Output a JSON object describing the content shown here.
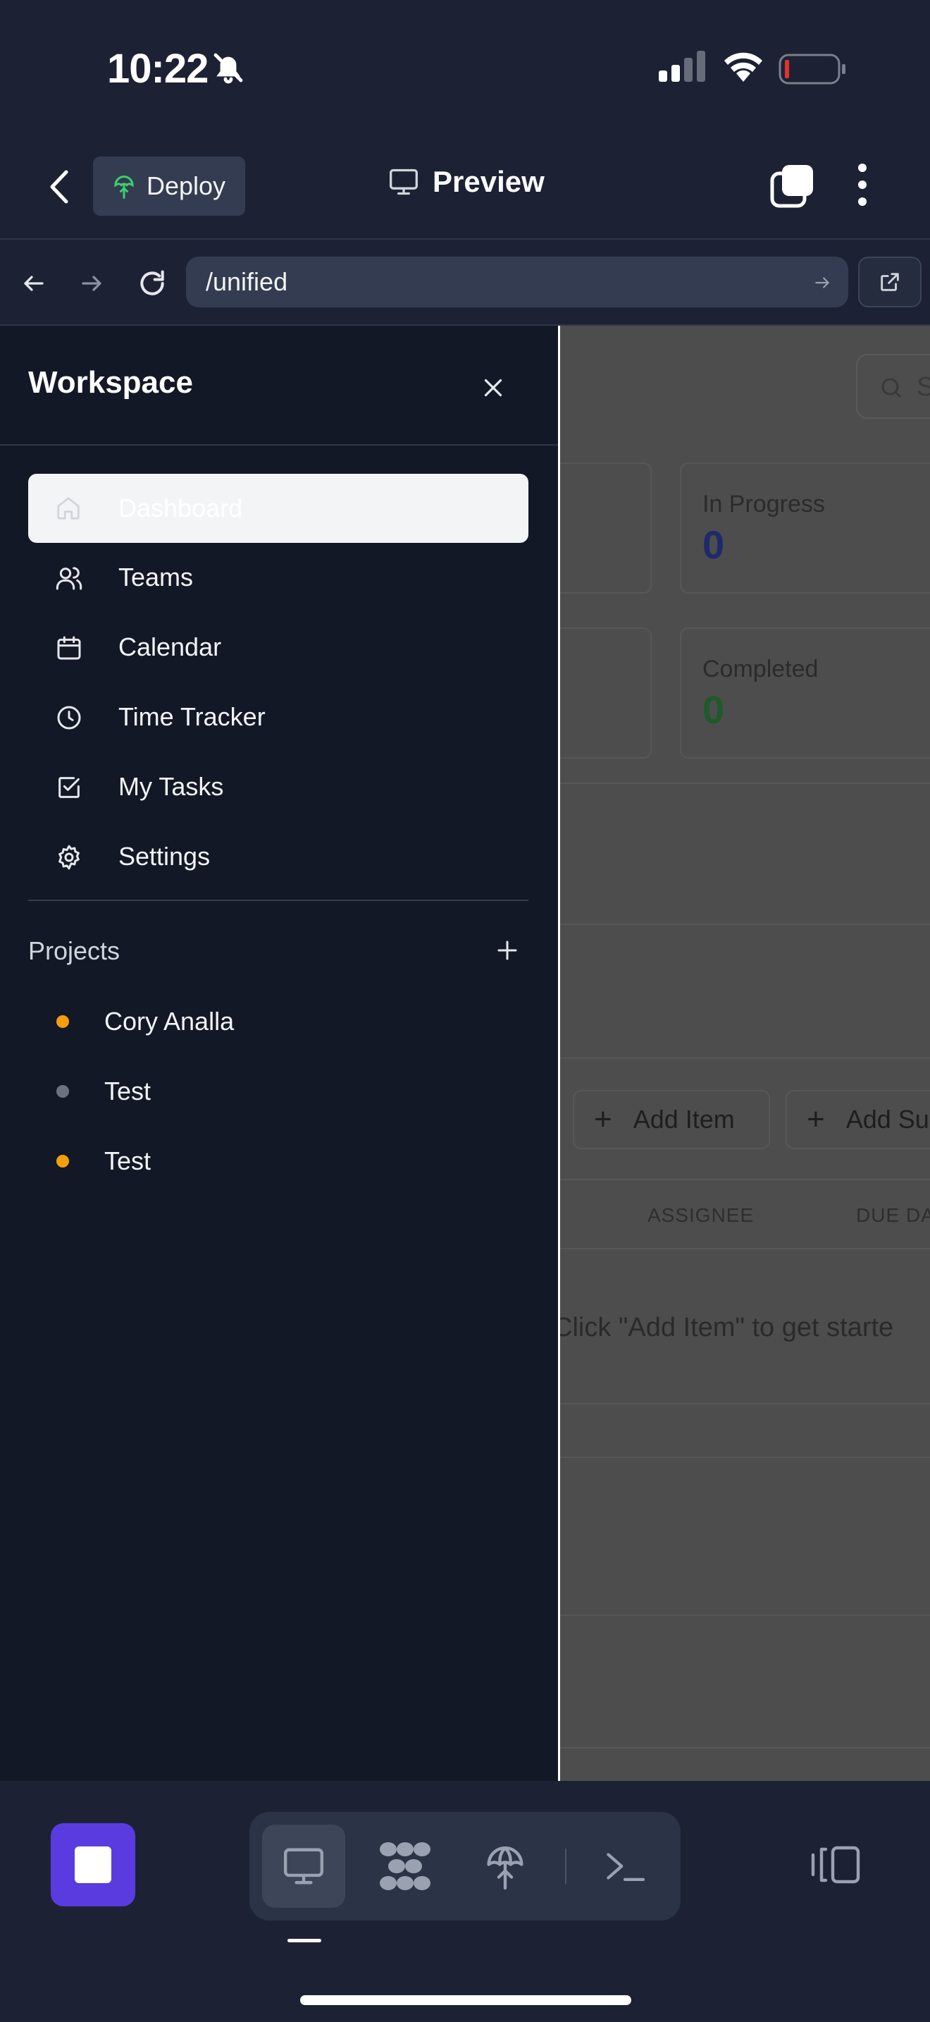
{
  "status_bar": {
    "time": "10:22"
  },
  "header": {
    "deploy_label": "Deploy",
    "title": "Preview"
  },
  "url_bar": {
    "url": "/unified"
  },
  "sidebar": {
    "title": "Workspace",
    "nav_items": [
      {
        "label": "Dashboard",
        "icon": "home-icon",
        "active": true
      },
      {
        "label": "Teams",
        "icon": "users-icon"
      },
      {
        "label": "Calendar",
        "icon": "calendar-icon"
      },
      {
        "label": "Time Tracker",
        "icon": "clock-icon"
      },
      {
        "label": "My Tasks",
        "icon": "checkbox-icon"
      },
      {
        "label": "Settings",
        "icon": "gear-icon"
      }
    ],
    "projects_label": "Projects",
    "projects": [
      {
        "label": "Cory Analla",
        "color": "#f59e0b"
      },
      {
        "label": "Test",
        "color": "#6b7280"
      },
      {
        "label": "Test",
        "color": "#f59e0b"
      }
    ]
  },
  "preview": {
    "search_placeholder": "S",
    "cards": [
      {
        "label": "In Progress",
        "value": "0",
        "color": "#1e2a6b"
      },
      {
        "label": "Completed",
        "value": "0",
        "color": "#1f5a2a"
      }
    ],
    "add_item_label": "Add Item",
    "add_sub_label": "Add Su",
    "columns": [
      "ASSIGNEE",
      "DUE DA"
    ],
    "empty_text": "Click \"Add Item\" to get starte"
  },
  "colors": {
    "accent": "#5a3be0",
    "background": "#1c2234",
    "sidebar": "#121826",
    "project_orange": "#f59e0b",
    "project_gray": "#6b7280"
  }
}
